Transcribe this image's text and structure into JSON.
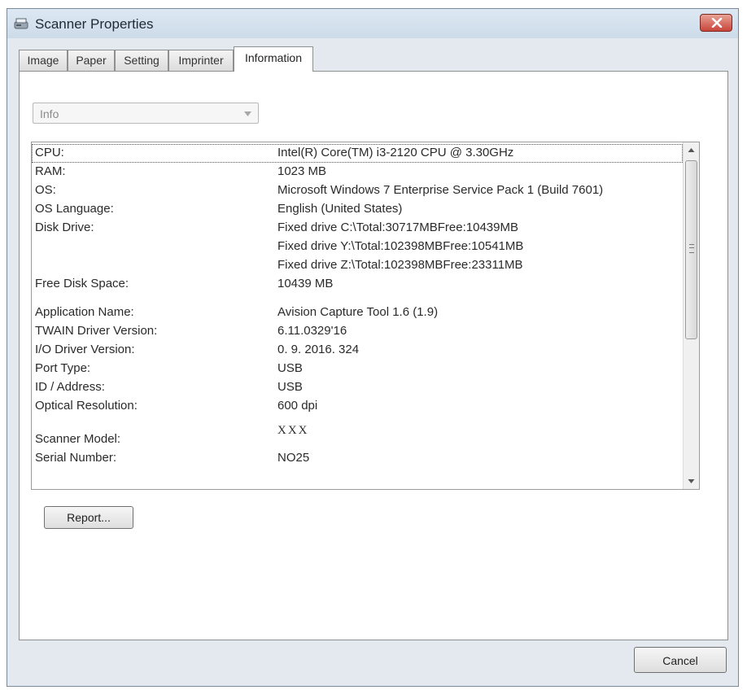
{
  "window": {
    "title": "Scanner Properties",
    "close_icon": "close-icon"
  },
  "tabs": [
    {
      "label": "Image"
    },
    {
      "label": "Paper"
    },
    {
      "label": "Setting"
    },
    {
      "label": "Imprinter"
    },
    {
      "label": "Information",
      "active": true
    }
  ],
  "info_select": {
    "value": "Info"
  },
  "info_rows": [
    {
      "label": "CPU:",
      "value": "Intel(R) Core(TM) i3-2120 CPU @ 3.30GHz"
    },
    {
      "label": "RAM:",
      "value": "1023 MB"
    },
    {
      "label": "OS:",
      "value": "Microsoft Windows 7 Enterprise Service Pack 1 (Build 7601)"
    },
    {
      "label": "OS Language:",
      "value": "English (United States)"
    },
    {
      "label": "Disk Drive:",
      "value": "Fixed drive C:\\Total:30717MBFree:10439MB"
    },
    {
      "label": "",
      "value": "Fixed drive Y:\\Total:102398MBFree:10541MB"
    },
    {
      "label": "",
      "value": "Fixed drive Z:\\Total:102398MBFree:23311MB"
    },
    {
      "label": "Free Disk Space:",
      "value": "10439 MB"
    },
    {
      "label": "Application Name:",
      "value": "Avision Capture Tool 1.6 (1.9)"
    },
    {
      "label": "TWAIN Driver Version:",
      "value": "6.11.0329'16"
    },
    {
      "label": "I/O Driver Version:",
      "value": "0. 9. 2016. 324"
    },
    {
      "label": "Port Type:",
      "value": "USB"
    },
    {
      "label": "ID / Address:",
      "value": "USB"
    },
    {
      "label": "Optical Resolution:",
      "value": "600 dpi"
    },
    {
      "label": "Scanner Model:",
      "value": "XXX"
    },
    {
      "label": "Serial Number:",
      "value": "NO25"
    }
  ],
  "buttons": {
    "report": "Report...",
    "cancel": "Cancel"
  },
  "colors": {
    "title_bar": "#cddbe9",
    "close_button": "#c9453a",
    "window_frame": "#e3e9ef"
  }
}
